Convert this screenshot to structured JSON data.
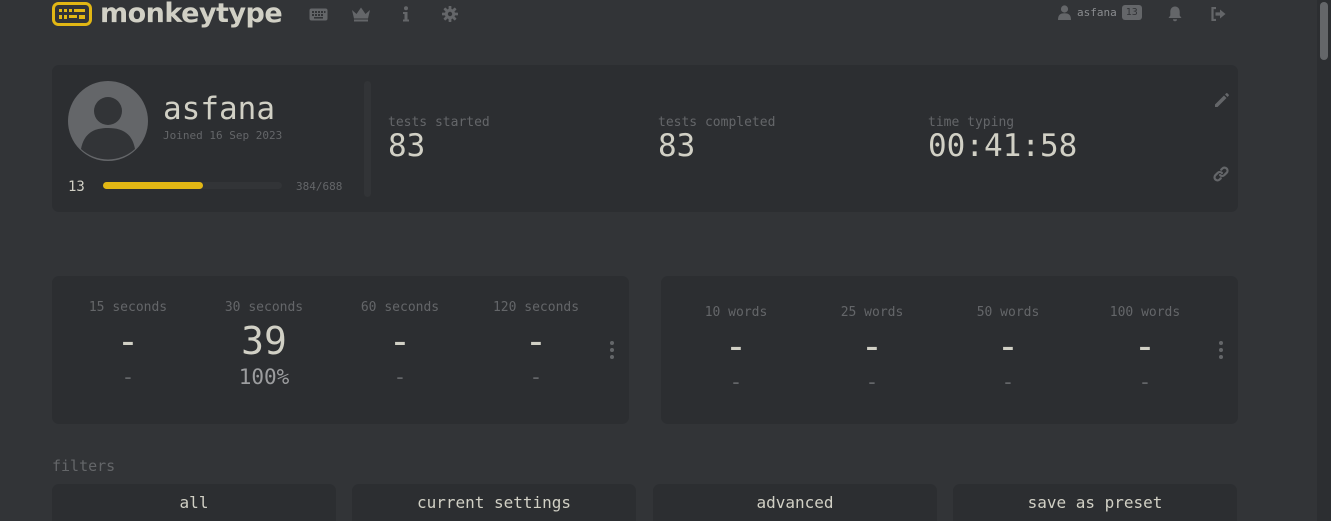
{
  "header": {
    "logo_text": "monkeytype",
    "nav_icons": [
      "keyboard-icon",
      "crown-icon",
      "info-icon",
      "gear-icon"
    ],
    "account_name": "asfana",
    "account_level": "13",
    "right_icons": [
      "bell-icon",
      "sign-out-icon"
    ]
  },
  "profile": {
    "username": "asfana",
    "joined": "Joined 16 Sep 2023",
    "level": "13",
    "xp_text": "384/688",
    "xp_progress": 0.558,
    "stats": [
      {
        "label": "tests started",
        "value": "83"
      },
      {
        "label": "tests completed",
        "value": "83"
      },
      {
        "label": "time typing",
        "value": "00:41:58"
      }
    ],
    "side_icons": [
      "pencil-icon",
      "link-icon"
    ]
  },
  "pb_time": [
    {
      "label": "15 seconds",
      "wpm": "-",
      "acc": "-"
    },
    {
      "label": "30 seconds",
      "wpm": "39",
      "acc": "100%"
    },
    {
      "label": "60 seconds",
      "wpm": "-",
      "acc": "-"
    },
    {
      "label": "120 seconds",
      "wpm": "-",
      "acc": "-"
    }
  ],
  "pb_words": [
    {
      "label": "10 words",
      "wpm": "-",
      "acc": "-"
    },
    {
      "label": "25 words",
      "wpm": "-",
      "acc": "-"
    },
    {
      "label": "50 words",
      "wpm": "-",
      "acc": "-"
    },
    {
      "label": "100 words",
      "wpm": "-",
      "acc": "-"
    }
  ],
  "filters": {
    "title": "filters",
    "buttons": [
      "all",
      "current settings",
      "advanced",
      "save as preset"
    ]
  },
  "colors": {
    "background": "#323437",
    "card": "#2c2e31",
    "accent": "#e2b714",
    "text": "#d1d0c5",
    "sub": "#646669"
  }
}
